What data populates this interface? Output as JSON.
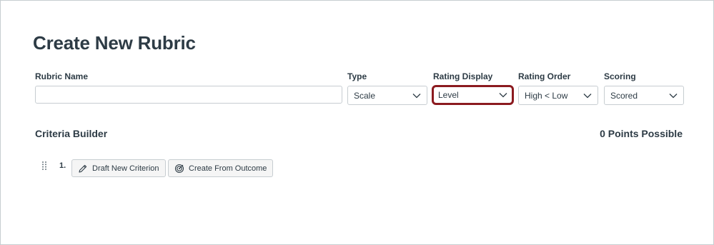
{
  "page": {
    "title": "Create New Rubric"
  },
  "form": {
    "rubric_name": {
      "label": "Rubric Name",
      "value": "",
      "placeholder": ""
    },
    "type": {
      "label": "Type",
      "selected": "Scale"
    },
    "rating_display": {
      "label": "Rating Display",
      "selected": "Level"
    },
    "rating_order": {
      "label": "Rating Order",
      "selected": "High < Low"
    },
    "scoring": {
      "label": "Scoring",
      "selected": "Scored"
    }
  },
  "criteria": {
    "heading": "Criteria Builder",
    "points_possible": "0 Points Possible",
    "row_number": "1.",
    "draft_button": "Draft New Criterion",
    "outcome_button": "Create From Outcome"
  },
  "colors": {
    "focus_ring": "#8b1a1f",
    "text": "#2d3b45",
    "border": "#c7cdd1"
  },
  "icons": [
    "chevron-down-icon",
    "drag-handle-icon",
    "pencil-icon",
    "target-icon"
  ]
}
